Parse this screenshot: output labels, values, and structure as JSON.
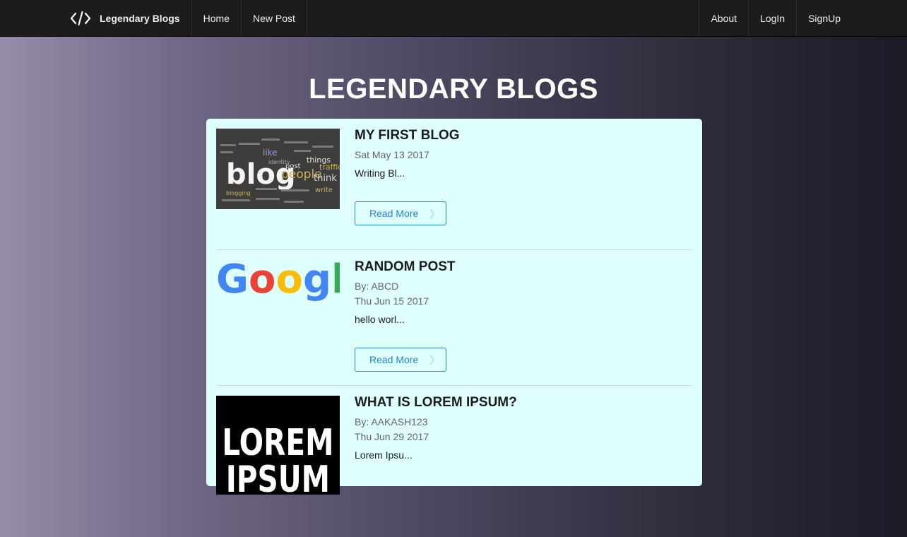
{
  "navbar": {
    "brand": "Legendary Blogs",
    "left_links": [
      "Home",
      "New Post"
    ],
    "right_links": [
      "About",
      "LogIn",
      "SignUp"
    ]
  },
  "hero": {
    "title": "LEGENDARY BLOGS"
  },
  "posts": [
    {
      "title": "MY FIRST BLOG",
      "date": "Sat May 13 2017",
      "excerpt": "Writing Bl...",
      "button": "Read More",
      "image_words": [
        "blog",
        "people",
        "like",
        "post",
        "things",
        "think",
        "traffic",
        "write",
        "blogging",
        "identity"
      ]
    },
    {
      "title": "RANDOM POST",
      "author": "By: ABCD",
      "date": "Thu Jun 15 2017",
      "excerpt": "hello worl...",
      "button": "Read More",
      "image_text": "Google"
    },
    {
      "title": "WHAT IS LOREM IPSUM?",
      "author": "By: AAKASH123",
      "date": "Thu Jun 29 2017",
      "excerpt": "Lorem Ipsu...",
      "image_text_1": "LOREM",
      "image_text_2": "IPSUM"
    }
  ],
  "colors": {
    "nav_bg": "#1b1c1d",
    "card_bg": "#dfffff",
    "button": "#2185d0"
  }
}
